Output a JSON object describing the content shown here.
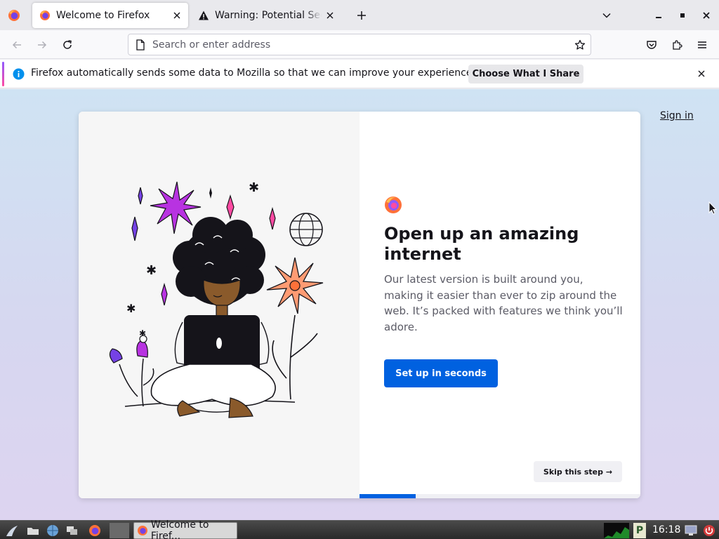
{
  "tabs": [
    {
      "title": "Welcome to Firefox",
      "active": true
    },
    {
      "title": "Warning: Potential Security Risk Ahead",
      "active": false
    }
  ],
  "urlbar": {
    "placeholder": "Search or enter address"
  },
  "notification": {
    "message": "Firefox automatically sends some data to Mozilla so that we can improve your experience.",
    "button_label": "Choose What I Share"
  },
  "content": {
    "signin": "Sign in",
    "title": "Open up an amazing internet",
    "subtitle": "Our latest version is built around you, making it easier than ever to zip around the web. It’s packed with features we think you’ll adore.",
    "primary_button": "Set up in seconds",
    "skip_button": "Skip this step →",
    "progress": 0.2
  },
  "taskbar": {
    "window_label": "Welcome to Firef...",
    "clock": "16:18"
  },
  "colors": {
    "accent_blue": "#0061e0",
    "notif_accent": "#9059ff",
    "info_blue": "#0090ed"
  },
  "icons": [
    "firefox-icon",
    "warning-icon",
    "close-icon",
    "plus-icon",
    "chevron-down-icon",
    "minimize-icon",
    "maximize-icon",
    "back-arrow-icon",
    "forward-arrow-icon",
    "reload-icon",
    "page-icon",
    "star-icon",
    "pocket-icon",
    "extensions-icon",
    "hamburger-menu-icon",
    "info-icon",
    "cursor-icon"
  ]
}
